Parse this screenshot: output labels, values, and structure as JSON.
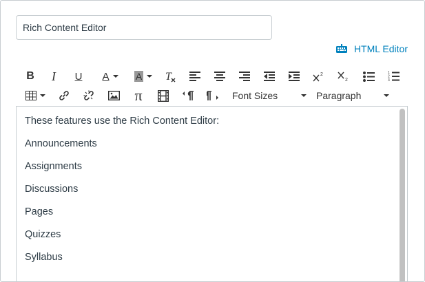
{
  "title_field": {
    "value": "Rich Content Editor"
  },
  "html_editor": {
    "label": "HTML Editor",
    "icon": "keyboard-icon"
  },
  "toolbar": {
    "font_sizes": "Font Sizes",
    "paragraph": "Paragraph",
    "buttons_row1": [
      "bold",
      "italic",
      "underline",
      "text-color",
      "background-color",
      "clear-formatting",
      "align-left",
      "align-center",
      "align-right",
      "outdent",
      "indent",
      "superscript",
      "subscript",
      "bullet-list",
      "numbered-list"
    ],
    "buttons_row2": [
      "table",
      "link",
      "unlink",
      "image",
      "math",
      "media",
      "ltr",
      "rtl",
      "font-sizes",
      "paragraph-format"
    ],
    "glyphs": {
      "bold": "B",
      "italic": "I",
      "underline": "U",
      "text_color": "A",
      "bg_color": "A",
      "clear": "T",
      "pi": "π"
    }
  },
  "content": {
    "lines": [
      "These features use the Rich Content Editor:",
      "Announcements",
      "Assignments",
      "Discussions",
      "Pages",
      "Quizzes",
      "Syllabus"
    ]
  },
  "colors": {
    "link": "#0081bd",
    "border": "#c7cdd1",
    "text": "#2d3b45"
  }
}
